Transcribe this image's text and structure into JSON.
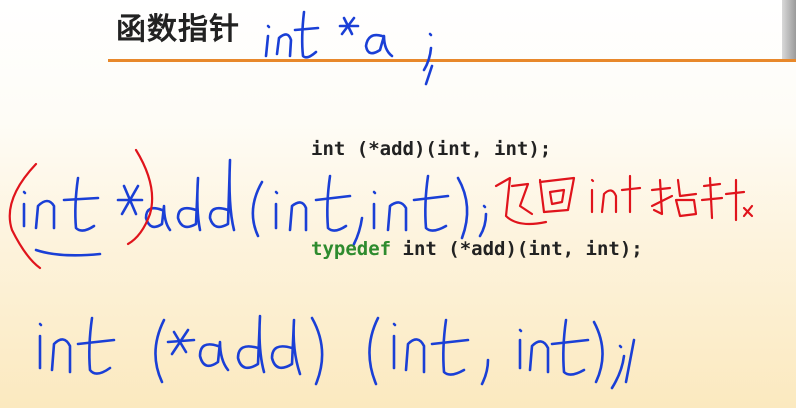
{
  "slide": {
    "title": "函数指针",
    "code_line_1": "int (*add)(int, int);",
    "code_line_2_keyword": "typedef",
    "code_line_2_rest": " int (*add)(int, int);"
  },
  "handwriting": {
    "title_note": "int *a;",
    "blue_line_1": "(int *)add(int ,int);",
    "red_note": "返回int指针 ×",
    "blue_line_3": "int (*add)(int, int);"
  },
  "colors": {
    "title_rule": "#e8882a",
    "keyword": "#2e8b2e",
    "ink_blue": "#1a3fd6",
    "ink_red": "#e0141c"
  }
}
